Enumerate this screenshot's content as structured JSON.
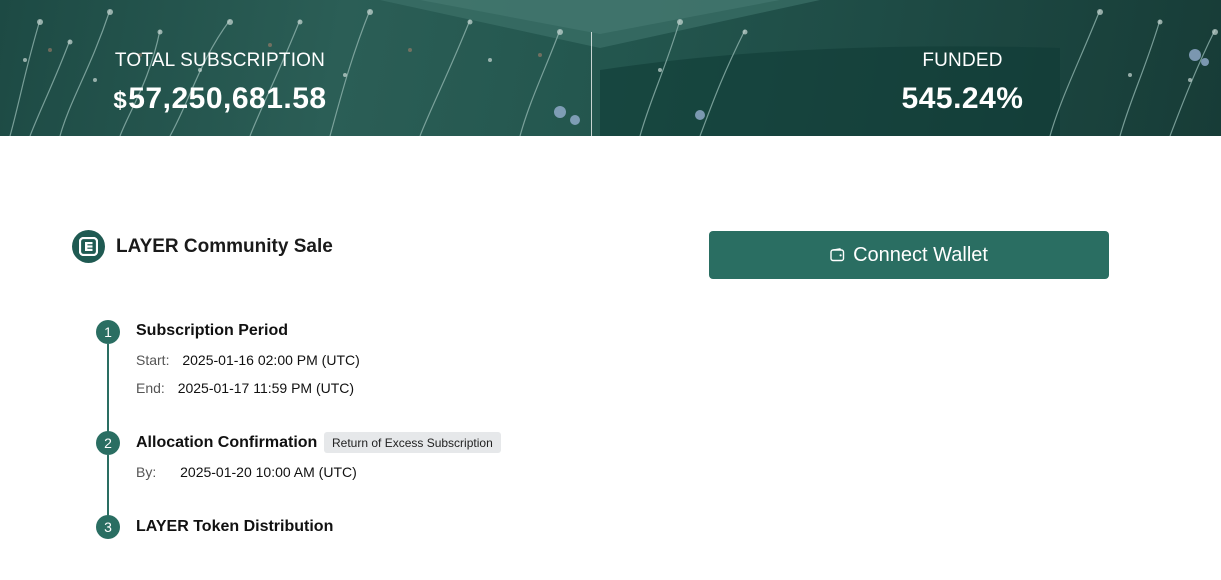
{
  "banner": {
    "total_subscription": {
      "label": "TOTAL SUBSCRIPTION",
      "currency": "$",
      "value": "57,250,681.58"
    },
    "funded": {
      "label": "FUNDED",
      "value": "545.24%"
    }
  },
  "sale": {
    "title": "LAYER Community Sale",
    "logo_icon": "layer-logo-icon"
  },
  "connect_button": {
    "label": "Connect Wallet",
    "icon": "wallet-icon"
  },
  "steps": [
    {
      "number": "1",
      "title": "Subscription Period",
      "rows": [
        {
          "key": "Start:",
          "value": "2025-01-16 02:00 PM (UTC)"
        },
        {
          "key": "End:",
          "value": "2025-01-17 11:59 PM (UTC)"
        }
      ]
    },
    {
      "number": "2",
      "title": "Allocation Confirmation",
      "badge": "Return of Excess Subscription",
      "rows": [
        {
          "key": "By:",
          "value": "2025-01-20 10:00 AM (UTC)"
        }
      ]
    },
    {
      "number": "3",
      "title": "LAYER Token Distribution"
    }
  ],
  "colors": {
    "brand_green": "#2a6e62",
    "banner_green": "#1d4a44"
  }
}
